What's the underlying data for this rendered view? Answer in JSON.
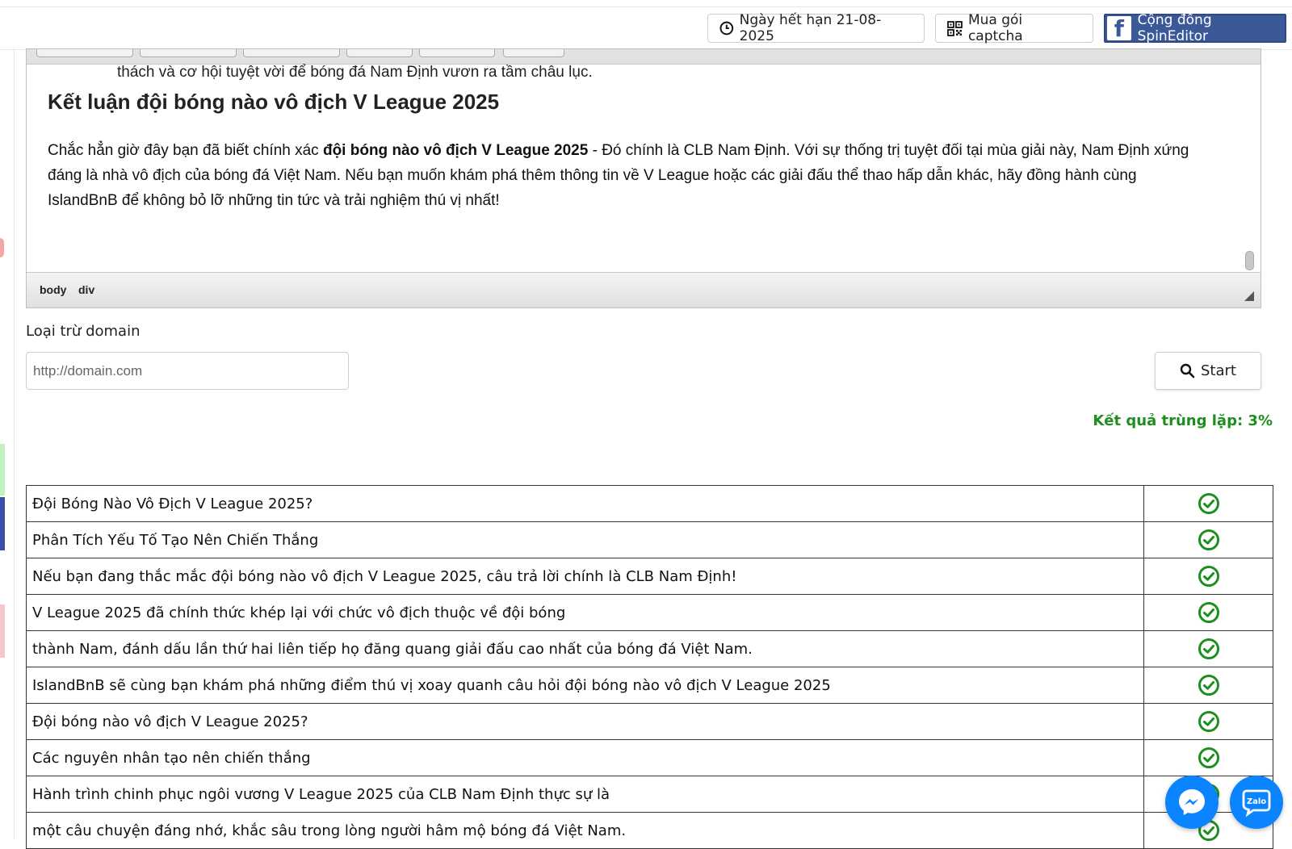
{
  "topbar": {
    "expiry_label": "Ngày hết hạn 21-08-2025",
    "captcha_label": "Mua gói captcha",
    "community_label": "Cộng đồng SpinEditor"
  },
  "editor": {
    "first_line": "thách và cơ hội tuyệt vời để bóng đá Nam Định vươn ra tầm châu lục.",
    "heading": "Kết luận đội bóng nào vô địch V League 2025",
    "para_start": "Chắc hẳn giờ đây bạn đã biết chính xác ",
    "para_bold": "đội bóng nào vô địch V League 2025",
    "para_rest": " - Đó chính là CLB Nam Định. Với sự thống trị tuyệt đối tại mùa giải này, Nam Định xứng đáng là nhà vô địch của bóng đá Việt Nam. Nếu bạn muốn khám phá thêm thông tin về V League hoặc các giải đấu thể thao hấp dẫn khác, hãy đồng hành cùng IslandBnB để không bỏ lỡ những tin tức và trải nghiệm thú vị nhất!",
    "status_path": [
      "body",
      "div"
    ]
  },
  "exclude": {
    "label": "Loại trừ domain",
    "placeholder": "http://domain.com",
    "start_label": "Start"
  },
  "result_text": "Kết quả trùng lặp: 3%",
  "rows": [
    "Đội Bóng Nào Vô Địch V League 2025?",
    "Phân Tích Yếu Tố Tạo Nên Chiến Thắng",
    "Nếu bạn đang thắc mắc đội bóng nào vô địch V League 2025, câu trả lời chính là CLB Nam Định!",
    "V League 2025 đã chính thức khép lại với chức vô địch thuộc về đội bóng",
    "thành Nam, đánh dấu lần thứ hai liên tiếp họ đăng quang giải đấu cao nhất của bóng đá Việt Nam.",
    "IslandBnB sẽ cùng bạn khám phá những điểm thú vị xoay quanh câu hỏi đội bóng nào vô địch V League 2025",
    "Đội bóng nào vô địch V League 2025?",
    "Các nguyên nhân tạo nên chiến thắng",
    "Hành trình chinh phục ngôi vương V League 2025 của CLB Nam Định thực sự là",
    "một câu chuyện đáng nhớ, khắc sâu trong lòng người hâm mộ bóng đá Việt Nam."
  ],
  "colors": {
    "check_green": "#1e8f1e",
    "facebook_blue": "#3b5998",
    "fab_blue": "#0a84ff"
  },
  "icons": {
    "expiry": "clock-icon",
    "captcha": "qr-code-icon",
    "community": "facebook-icon",
    "start": "search-icon",
    "row_status": "check-circle-icon",
    "fab_1": "messenger-icon",
    "fab_2": "zalo-icon"
  }
}
